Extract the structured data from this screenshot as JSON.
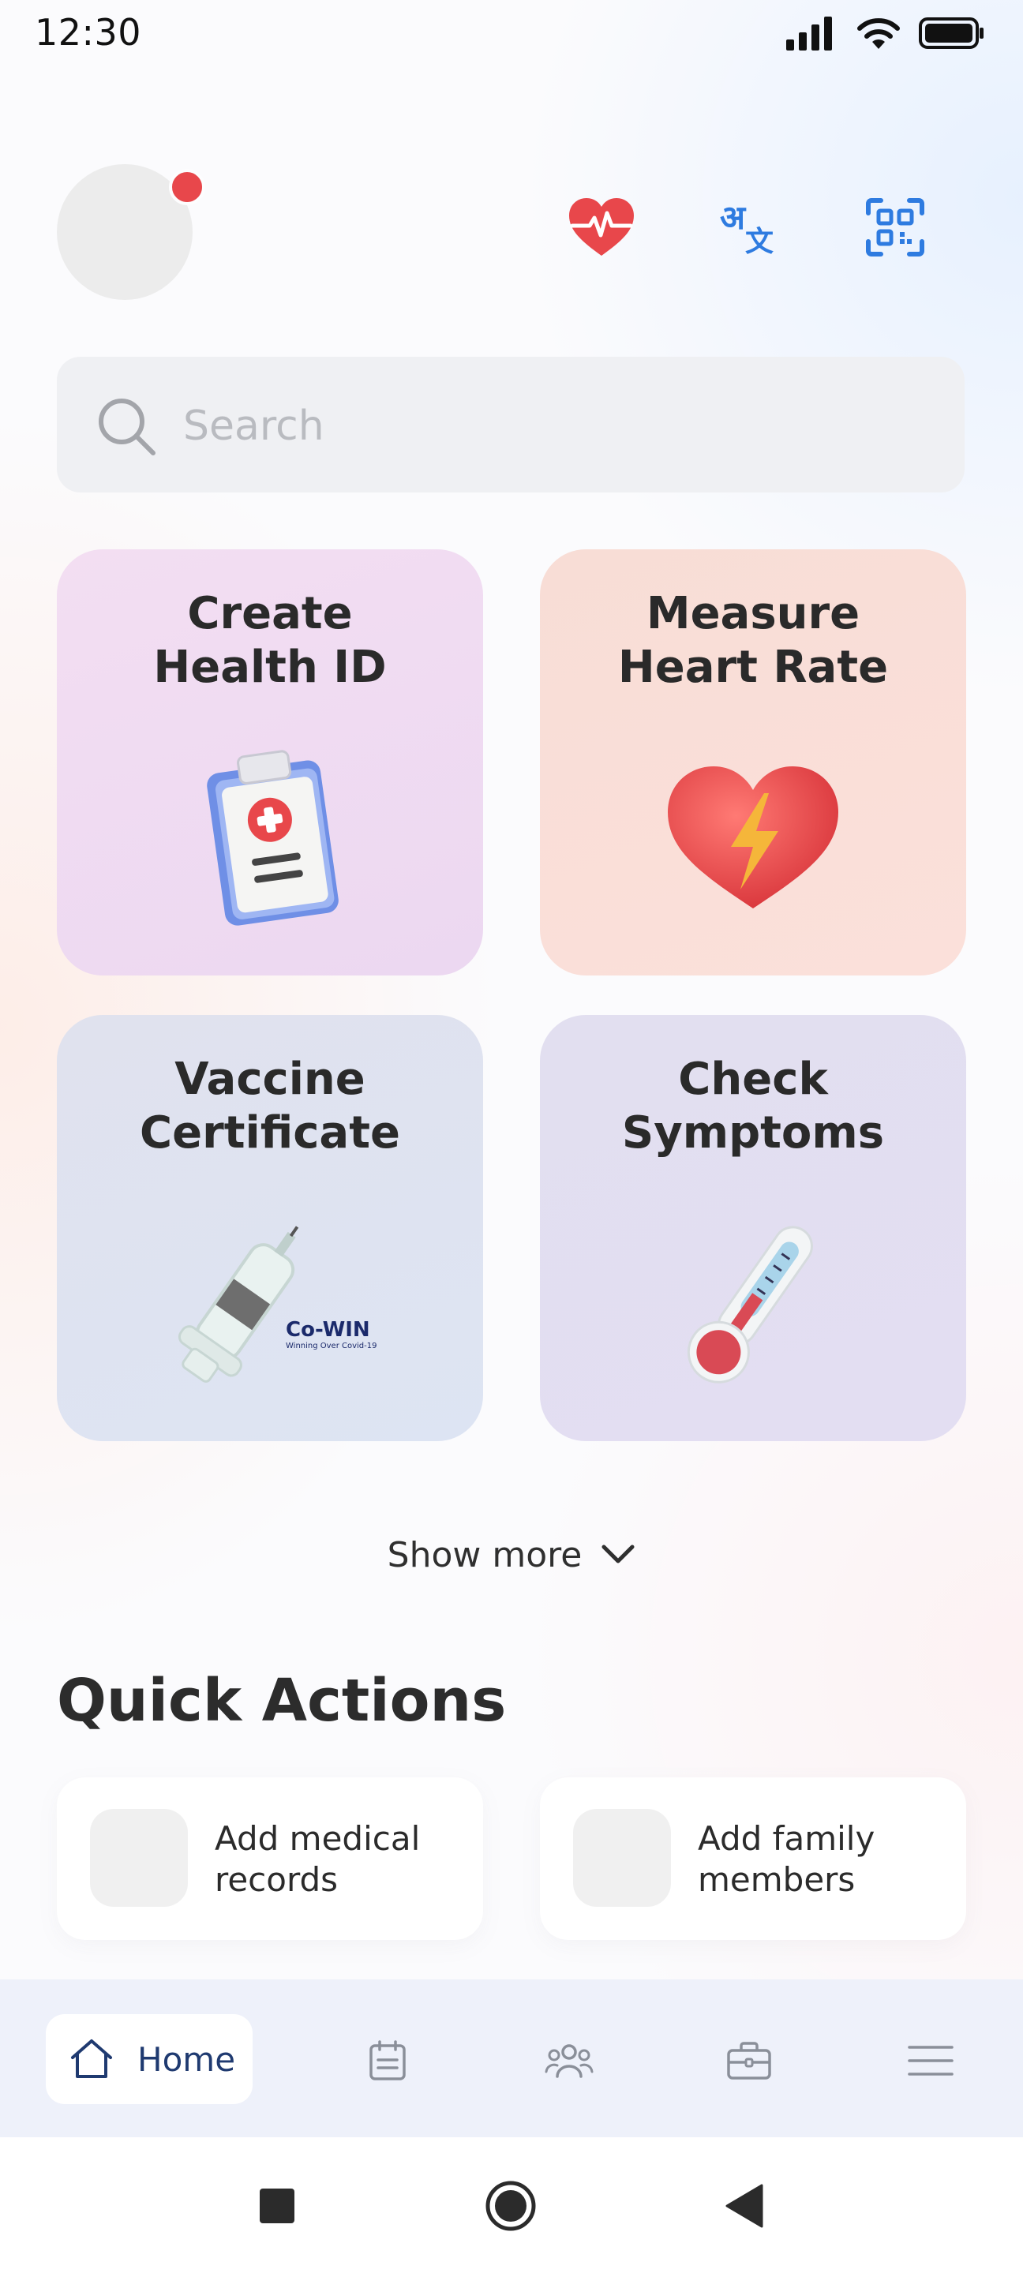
{
  "status_bar": {
    "time": "12:30"
  },
  "search": {
    "placeholder": "Search"
  },
  "cards": {
    "health_id": "Create\nHealth ID",
    "heart_rate": "Measure\nHeart Rate",
    "vaccine": "Vaccine\nCertificate",
    "symptoms": "Check\nSymptoms",
    "cowin_logo": "Co-WIN",
    "cowin_tagline": "Winning Over Covid-19"
  },
  "show_more": {
    "label": "Show more"
  },
  "quick_actions": {
    "title": "Quick Actions",
    "items": [
      {
        "label": "Add medical\nrecords"
      },
      {
        "label": "Add family\nmembers"
      }
    ]
  },
  "bottom_nav": {
    "items": [
      {
        "label": "Home",
        "icon": "home-icon",
        "active": true
      },
      {
        "icon": "calendar-icon"
      },
      {
        "icon": "people-icon"
      },
      {
        "icon": "briefcase-icon"
      },
      {
        "icon": "menu-icon"
      }
    ]
  },
  "colors": {
    "accent_red": "#e8474b",
    "accent_blue": "#2e7be0",
    "nav_text": "#1f3a70"
  }
}
